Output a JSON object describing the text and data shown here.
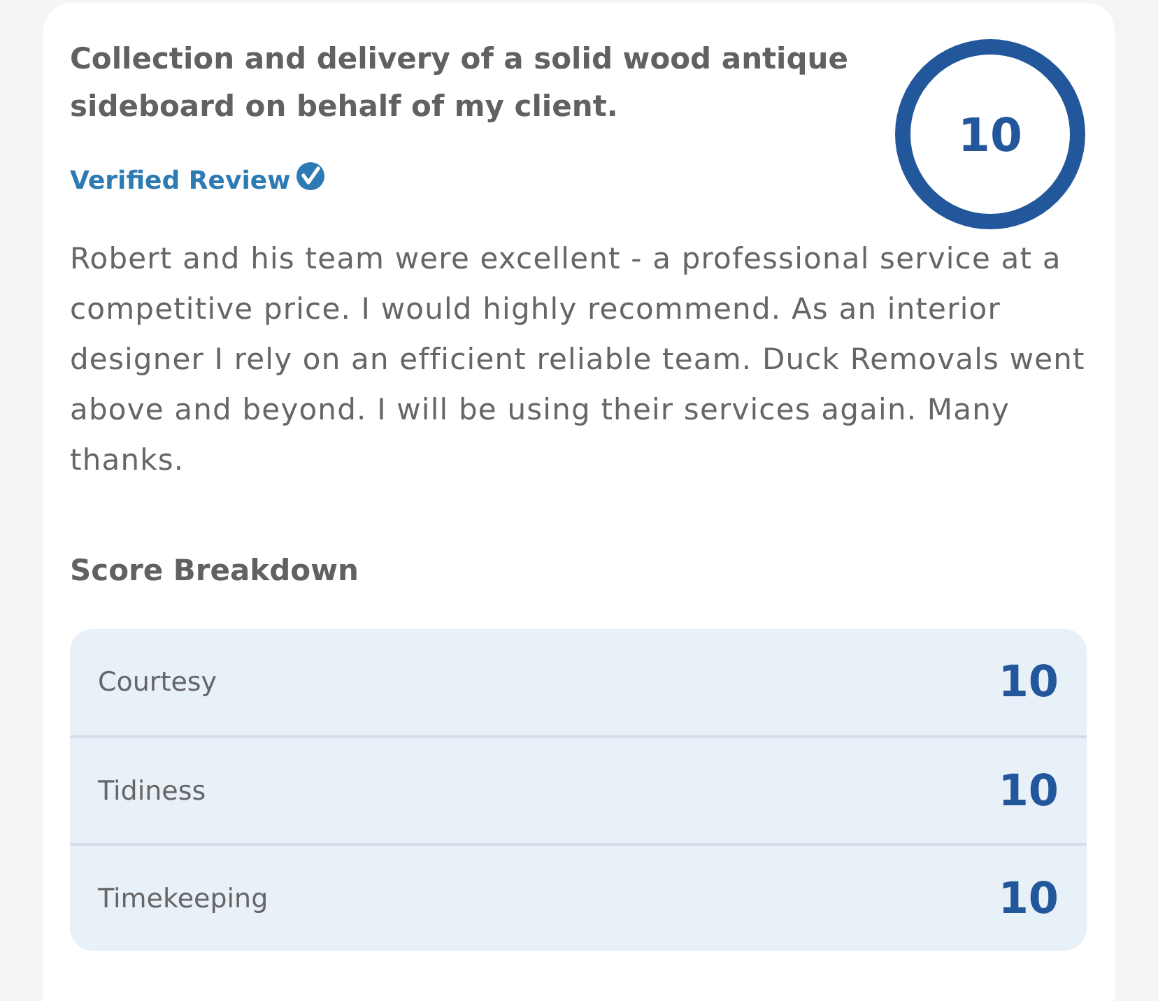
{
  "review": {
    "title": "Collection and delivery of a solid wood antique sideboard on behalf of my client.",
    "verified_label": "Verified Review",
    "overall_score": "10",
    "text": "Robert and his team were excellent - a professional service at a competitive price. I would highly recommend. As an interior designer I rely on an efficient reliable team. Duck Removals went above and beyond. I will be using their services again. Many thanks."
  },
  "score_breakdown": {
    "heading": "Score Breakdown",
    "rows": [
      {
        "label": "Courtesy",
        "score": "10"
      },
      {
        "label": "Tidiness",
        "score": "10"
      },
      {
        "label": "Timekeeping",
        "score": "10"
      }
    ]
  }
}
